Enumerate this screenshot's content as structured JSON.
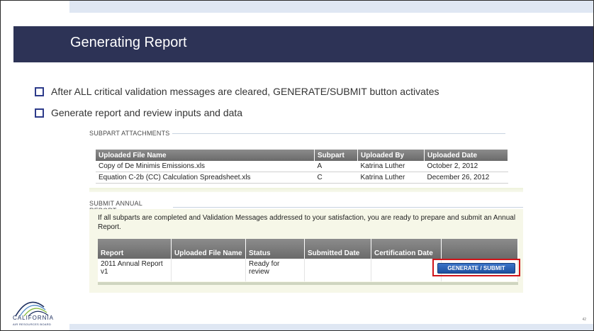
{
  "slide": {
    "title": "Generating Report",
    "bullets": [
      "After ALL critical validation messages are cleared, GENERATE/SUBMIT button activates",
      "Generate report and review inputs and data"
    ],
    "page_number": "42"
  },
  "attachments": {
    "section_label": "SUBPART ATTACHMENTS",
    "columns": [
      "Uploaded File Name",
      "Subpart",
      "Uploaded By",
      "Uploaded Date"
    ],
    "rows": [
      [
        "Copy of De Minimis Emissions.xls",
        "A",
        "Katrina Luther",
        "October 2, 2012"
      ],
      [
        "Equation C-2b (CC) Calculation Spreadsheet.xls",
        "C",
        "Katrina Luther",
        "December 26, 2012"
      ]
    ]
  },
  "annual_report": {
    "section_label": "SUBMIT ANNUAL REPORT",
    "description": "If all subparts are completed and Validation Messages addressed to your satisfaction, you are ready to prepare and submit an Annual Report.",
    "columns": [
      "Report",
      "Uploaded File Name",
      "Status",
      "Submitted Date",
      "Certification Date",
      ""
    ],
    "row": {
      "report": "2011 Annual Report v1",
      "uploaded_file_name": "",
      "status": "Ready for review",
      "submitted_date": "",
      "certification_date": ""
    },
    "button_label": "GENERATE / SUBMIT"
  },
  "logo": {
    "name": "CALIFORNIA",
    "subtitle": "AIR RESOURCES BOARD"
  }
}
